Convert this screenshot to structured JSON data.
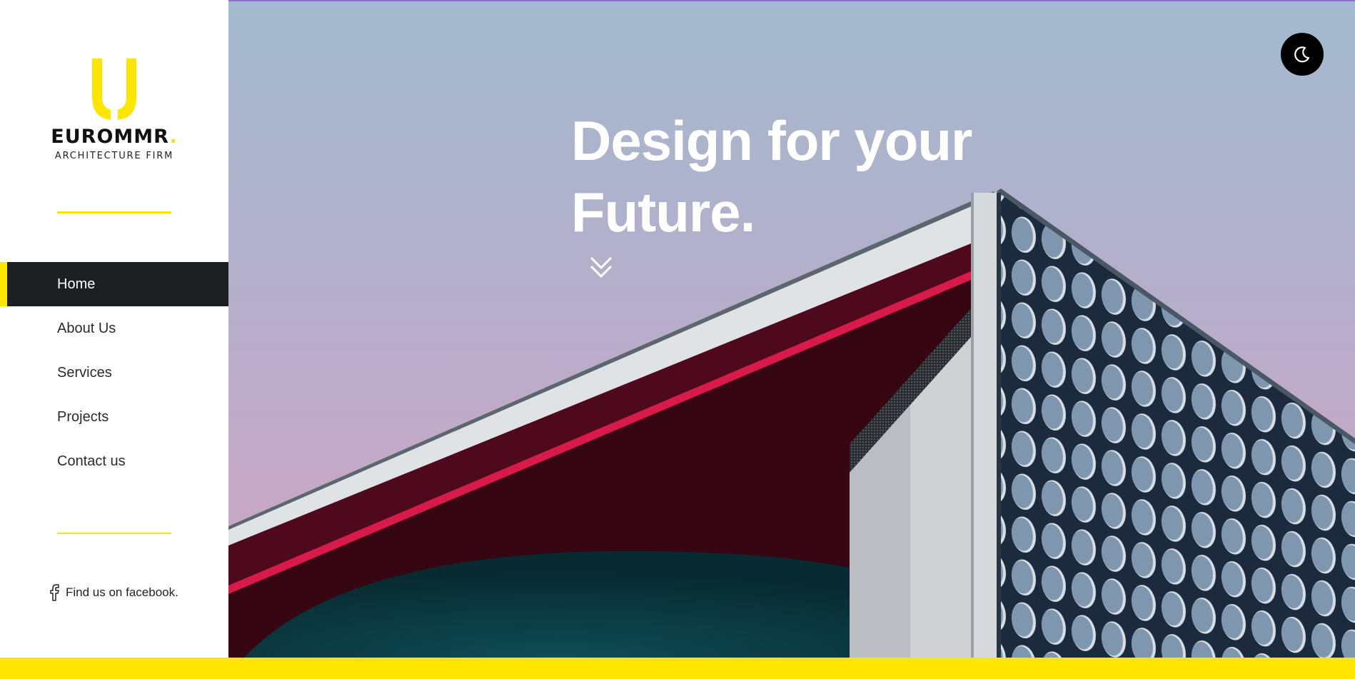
{
  "brand": {
    "name": "EUROMMR",
    "dot": ".",
    "tagline": "ARCHITECTURE FIRM",
    "accent_color": "#ffe600",
    "logo_icon": "u-logo-icon"
  },
  "nav": {
    "items": [
      {
        "label": "Home",
        "active": true
      },
      {
        "label": "About Us",
        "active": false
      },
      {
        "label": "Services",
        "active": false
      },
      {
        "label": "Projects",
        "active": false
      },
      {
        "label": "Contact us",
        "active": false
      }
    ],
    "active_bg": "#1c1f21"
  },
  "social": {
    "facebook_label": "Find us on facebook.",
    "icon": "facebook-icon"
  },
  "hero": {
    "headline_line1": "Design for your",
    "headline_line2": "Future.",
    "scroll_icon": "chevron-double-down-icon"
  },
  "theme_toggle": {
    "icon": "moon-icon"
  }
}
